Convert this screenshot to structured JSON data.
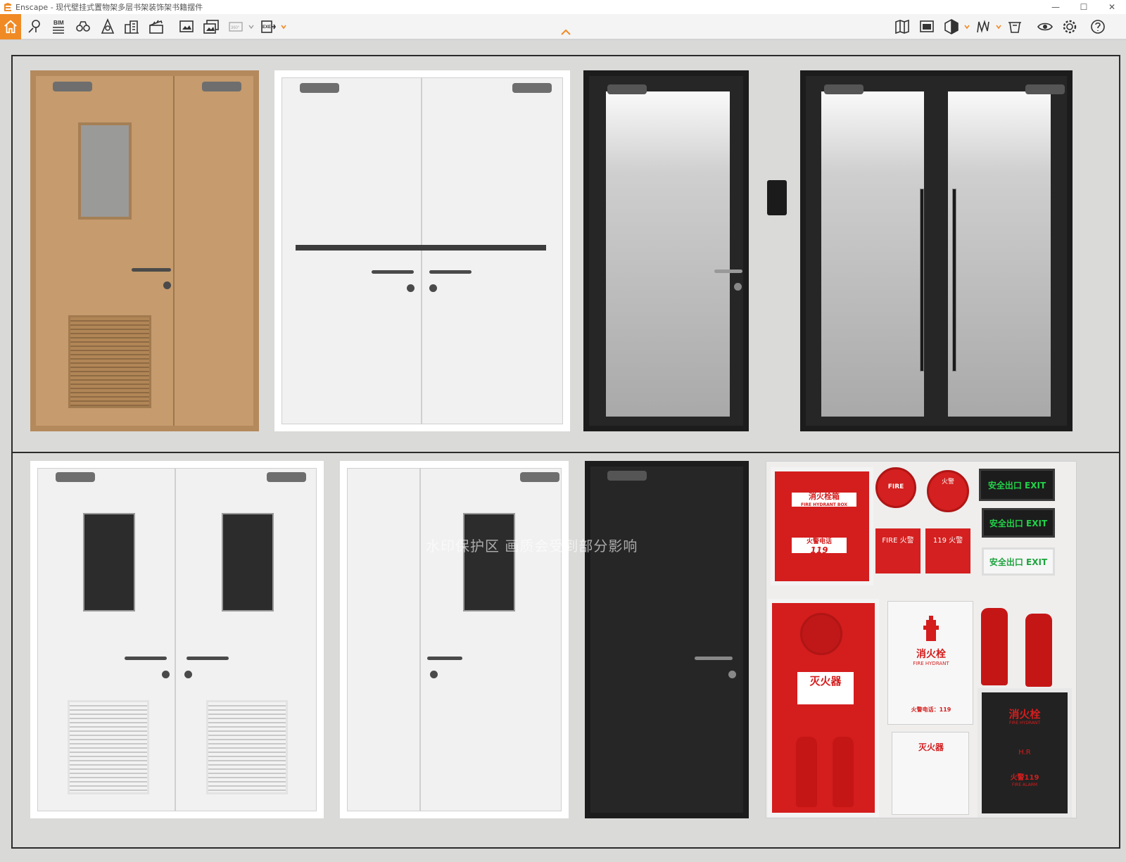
{
  "window": {
    "title": "Enscape - 现代壁挂式置物架多层书架装饰架书籍摆件",
    "minimize": "—",
    "maximize": "☐",
    "close": "✕"
  },
  "toolbar": {
    "bim_label": "BIM",
    "tools": [
      "home-icon",
      "pin-icon",
      "bim-icon",
      "binoculars-icon",
      "artist-icon",
      "buildings-icon",
      "clapper-icon",
      "screenshot-icon",
      "batch-render-icon",
      "panorama-360-icon",
      "exe-export-icon",
      "map-icon",
      "info-screen-icon",
      "cube-icon",
      "library-icon",
      "asset-icon",
      "eye-icon",
      "gear-icon",
      "help-icon"
    ],
    "accent": "#f08a24"
  },
  "scene": {
    "watermark": "水印保护区  画质会受到部分影响",
    "hydrant_box_label": "消火栓箱",
    "hydrant_box_sub": "FIRE HYDRANT BOX",
    "alarm_phone": "火警电话",
    "alarm_phone_num": "119",
    "fire_round": "FIRE",
    "fire_round_2": "火警",
    "alarm_btn_1": "FIRE 火警",
    "alarm_btn_2": "119 火警",
    "exit_1": "安全出口 EXIT",
    "exit_2": "安全出口 EXIT",
    "exit_3": "安全出口 EXIT",
    "extinguisher_label": "灭火器",
    "hydrant_label": "消火栓",
    "hydrant_sub": "FIRE HYDRANT",
    "hydrant_phone": "火警电话：119",
    "extinguisher_label_2": "灭火器",
    "hydrant_cab_label": "消火栓",
    "hydrant_cab_sub": "FIRE HYDRANT",
    "hydrant_cab_num": "H.R",
    "hydrant_cab_phone": "火警119",
    "hydrant_cab_alarm": "FIRE ALARM"
  }
}
